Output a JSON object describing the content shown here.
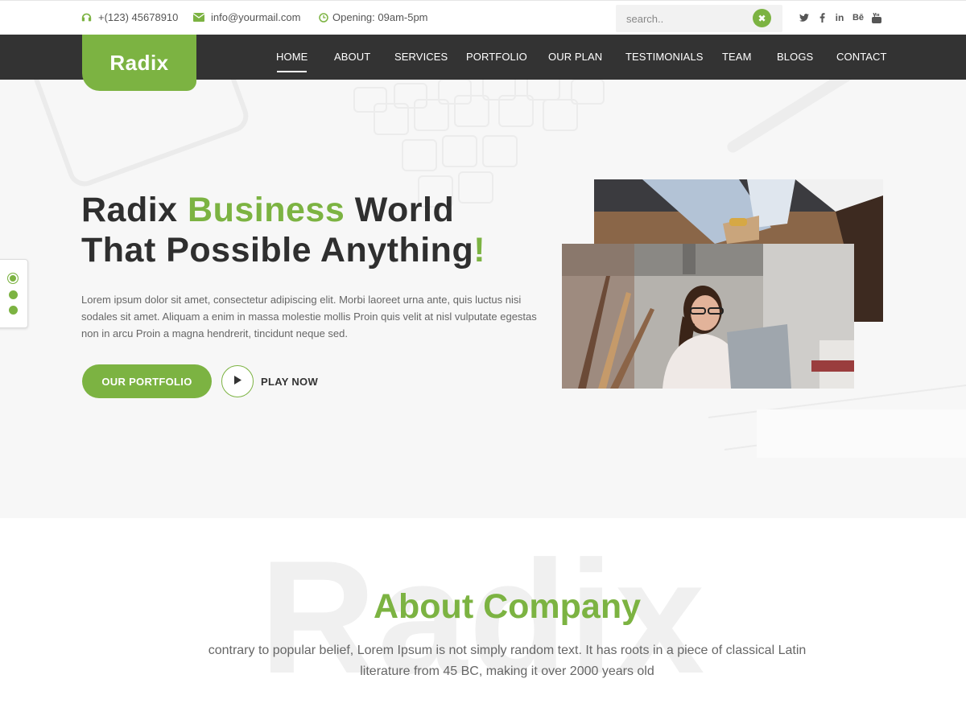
{
  "topbar": {
    "phone": "+(123) 45678910",
    "email": "info@yourmail.com",
    "opening": "Opening: 09am-5pm",
    "search_placeholder": "search.."
  },
  "brand": {
    "logo": "Radix"
  },
  "nav": {
    "items": [
      {
        "label": "HOME"
      },
      {
        "label": "ABOUT"
      },
      {
        "label": "SERVICES"
      },
      {
        "label": "PORTFOLIO"
      },
      {
        "label": "OUR PLAN"
      },
      {
        "label": "TESTIMONIALS"
      },
      {
        "label": "TEAM"
      },
      {
        "label": "BLOGS"
      },
      {
        "label": "CONTACT"
      }
    ]
  },
  "hero": {
    "title_part1": "Radix ",
    "title_highlight": "Business",
    "title_part2": " World",
    "title_line2": "That Possible Anything",
    "title_excl": "!",
    "text": "Lorem ipsum dolor sit amet, consectetur adipiscing elit. Morbi laoreet urna ante, quis luctus nisi sodales sit amet. Aliquam a enim in massa molestie mollis Proin quis velit at nisl vulputate egestas non in arcu Proin a magna hendrerit, tincidunt neque sed.",
    "primary_button": "OUR PORTFOLIO",
    "play_label": "PLAY NOW"
  },
  "about": {
    "bg_word": "Radix",
    "title": "About Company",
    "text": "contrary to popular belief, Lorem Ipsum is not simply random text. It has roots in a piece of classical Latin literature from 45 BC, making it over 2000 years old"
  },
  "colors": {
    "accent": "#7cb342",
    "nav_bg": "#333333",
    "title": "#2f2f2f"
  }
}
